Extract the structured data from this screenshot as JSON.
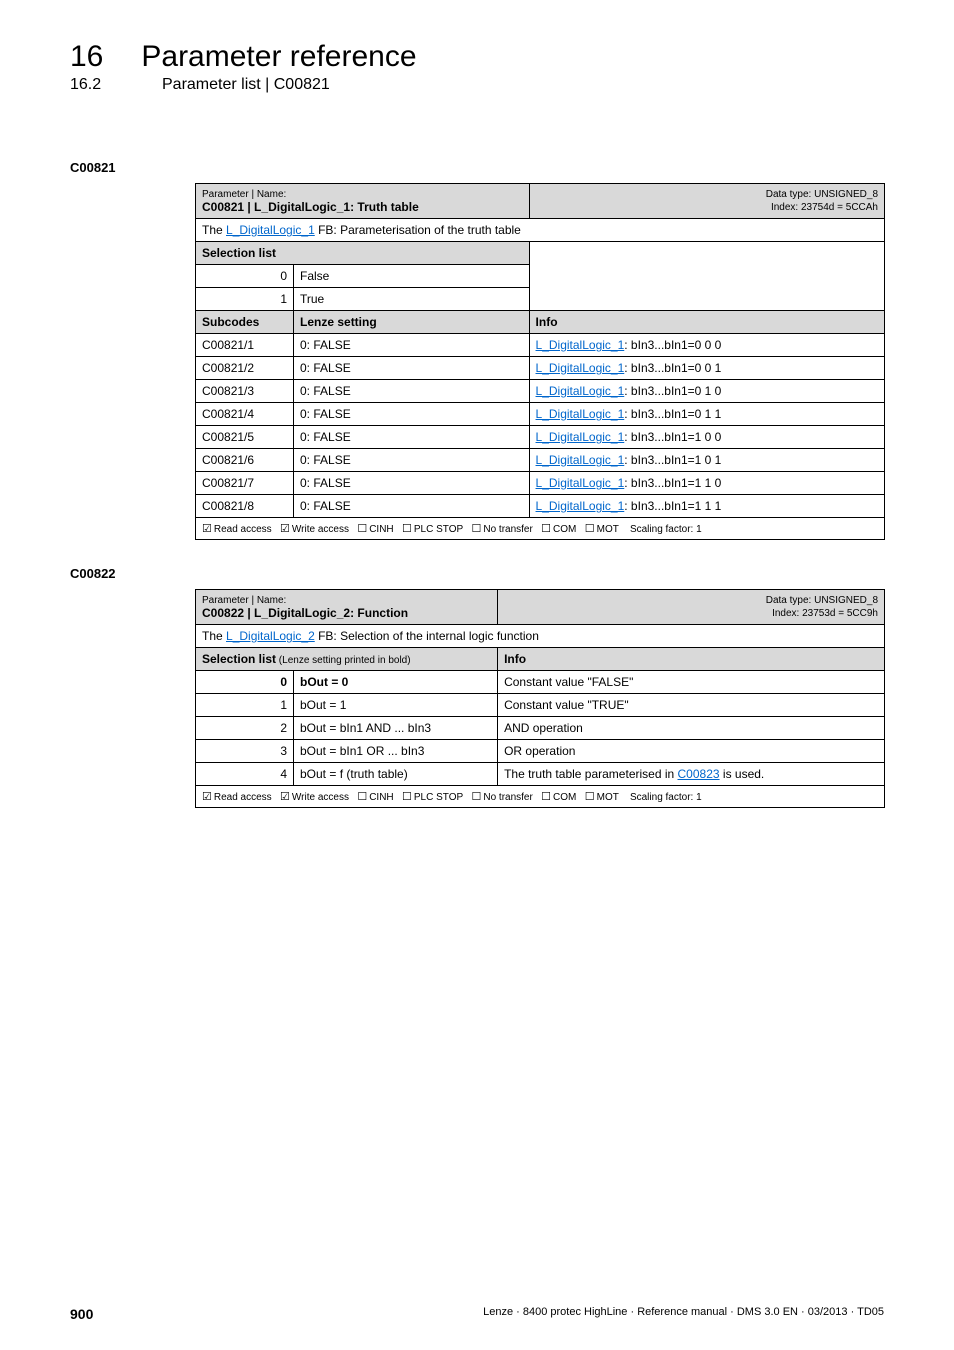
{
  "header": {
    "chapter_num": "16",
    "chapter_title": "Parameter reference",
    "sub_num": "16.2",
    "sub_title": "Parameter list | C00821"
  },
  "dashes": "_ _ _ _ _ _ _ _ _ _ _ _ _ _ _ _ _ _ _ _ _ _ _ _ _ _ _ _ _ _ _ _ _ _ _ _ _ _ _ _ _ _ _ _ _ _ _ _ _ _ _ _ _ _ _ _ _ _ _ _ _ _ _ _",
  "p1": {
    "label": "C00821",
    "meta_top": "Parameter | Name:",
    "name": "C00821 | L_DigitalLogic_1: Truth table",
    "dtype": "Data type: UNSIGNED_8",
    "index": "Index: 23754d = 5CCAh",
    "desc_prefix": "The ",
    "desc_link": "L_DigitalLogic_1",
    "desc_suffix": " FB: Parameterisation of the truth table",
    "sel_header": "Selection list",
    "sel": [
      {
        "n": "0",
        "v": "False"
      },
      {
        "n": "1",
        "v": "True"
      }
    ],
    "sub_headers": {
      "a": "Subcodes",
      "b": "Lenze setting",
      "c": "Info"
    },
    "rows": [
      {
        "code": "C00821/1",
        "setting": "0: FALSE",
        "info_link": "L_DigitalLogic_1",
        "info_suffix": ": bIn3...bIn1=0 0 0"
      },
      {
        "code": "C00821/2",
        "setting": "0: FALSE",
        "info_link": "L_DigitalLogic_1",
        "info_suffix": ": bIn3...bIn1=0 0 1"
      },
      {
        "code": "C00821/3",
        "setting": "0: FALSE",
        "info_link": "L_DigitalLogic_1",
        "info_suffix": ": bIn3...bIn1=0 1 0"
      },
      {
        "code": "C00821/4",
        "setting": "0: FALSE",
        "info_link": "L_DigitalLogic_1",
        "info_suffix": ": bIn3...bIn1=0 1 1"
      },
      {
        "code": "C00821/5",
        "setting": "0: FALSE",
        "info_link": "L_DigitalLogic_1",
        "info_suffix": ": bIn3...bIn1=1 0 0"
      },
      {
        "code": "C00821/6",
        "setting": "0: FALSE",
        "info_link": "L_DigitalLogic_1",
        "info_suffix": ": bIn3...bIn1=1 0 1"
      },
      {
        "code": "C00821/7",
        "setting": "0: FALSE",
        "info_link": "L_DigitalLogic_1",
        "info_suffix": ": bIn3...bIn1=1 1 0"
      },
      {
        "code": "C00821/8",
        "setting": "0: FALSE",
        "info_link": "L_DigitalLogic_1",
        "info_suffix": ": bIn3...bIn1=1 1 1"
      }
    ],
    "footer": {
      "read": "Read access",
      "write": "Write access",
      "cinh": "CINH",
      "plc": "PLC STOP",
      "notransfer": "No transfer",
      "com": "COM",
      "mot": "MOT",
      "scaling": "Scaling factor: 1"
    }
  },
  "p2": {
    "label": "C00822",
    "meta_top": "Parameter | Name:",
    "name": "C00822 | L_DigitalLogic_2: Function",
    "dtype": "Data type: UNSIGNED_8",
    "index": "Index: 23753d = 5CC9h",
    "desc_prefix": "The ",
    "desc_link": "L_DigitalLogic_2",
    "desc_suffix": " FB: Selection of the internal logic function",
    "sel_header_a": "Selection list",
    "sel_header_a_suffix": " (Lenze setting printed in bold)",
    "sel_header_b": "Info",
    "rows": [
      {
        "n": "0",
        "v": "bOut = 0",
        "bold": true,
        "info": "Constant value \"FALSE\""
      },
      {
        "n": "1",
        "v": "bOut = 1",
        "info": "Constant value \"TRUE\""
      },
      {
        "n": "2",
        "v": "bOut = bIn1 AND ... bIn3",
        "info": "AND operation"
      },
      {
        "n": "3",
        "v": "bOut = bIn1 OR ... bIn3",
        "info": "OR operation"
      },
      {
        "n": "4",
        "v": "bOut = f (truth table)",
        "info_prefix": "The truth table parameterised in ",
        "info_link": "C00823",
        "info_suffix": " is used."
      }
    ],
    "footer": {
      "read": "Read access",
      "write": "Write access",
      "cinh": "CINH",
      "plc": "PLC STOP",
      "notransfer": "No transfer",
      "com": "COM",
      "mot": "MOT",
      "scaling": "Scaling factor: 1"
    }
  },
  "footer_page": {
    "num": "900",
    "text": "Lenze · 8400 protec HighLine · Reference manual · DMS 3.0 EN · 03/2013 · TD05"
  }
}
